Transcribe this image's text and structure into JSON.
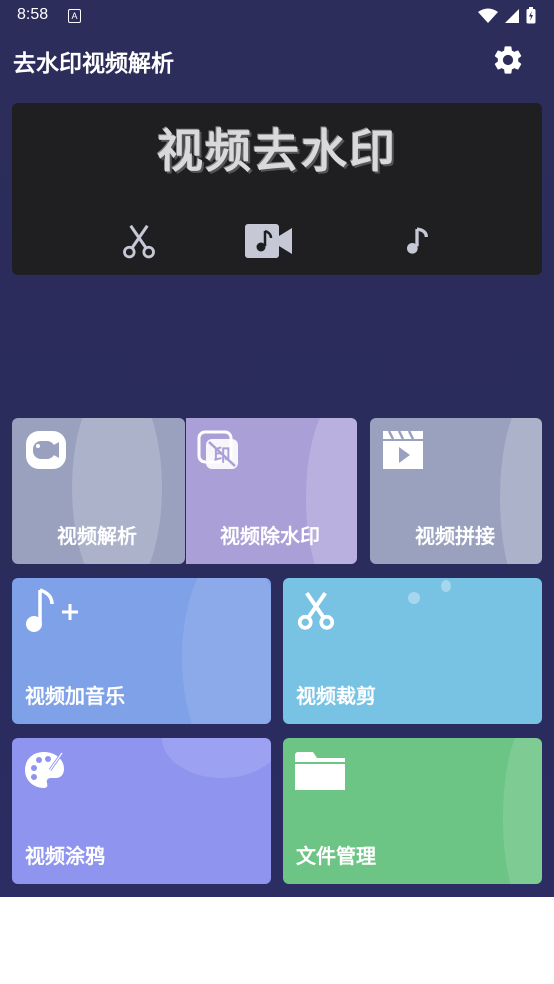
{
  "status_bar": {
    "time": "8:58",
    "notification_letter": "A"
  },
  "app_bar": {
    "title": "去水印视频解析",
    "settings_icon": "gear-icon"
  },
  "banner": {
    "title": "视频去水印",
    "icons": [
      "scissors-icon",
      "video-music-icon",
      "music-note-icon"
    ]
  },
  "tiles": [
    {
      "label": "视频解析",
      "icon": "video-camera-icon",
      "color": "#9aa1be"
    },
    {
      "label": "视频除水印",
      "icon": "remove-watermark-icon",
      "color": "#ab9fd8"
    },
    {
      "label": "视频拼接",
      "icon": "clapperboard-icon",
      "color": "#9aa1be"
    },
    {
      "label": "视频加音乐",
      "icon": "add-music-icon",
      "color": "#7fa1e8"
    },
    {
      "label": "视频裁剪",
      "icon": "scissors-icon",
      "color": "#78c2e4"
    },
    {
      "label": "视频涂鸦",
      "icon": "palette-icon",
      "color": "#8f94ef"
    },
    {
      "label": "文件管理",
      "icon": "folder-icon",
      "color": "#6dc585"
    }
  ]
}
